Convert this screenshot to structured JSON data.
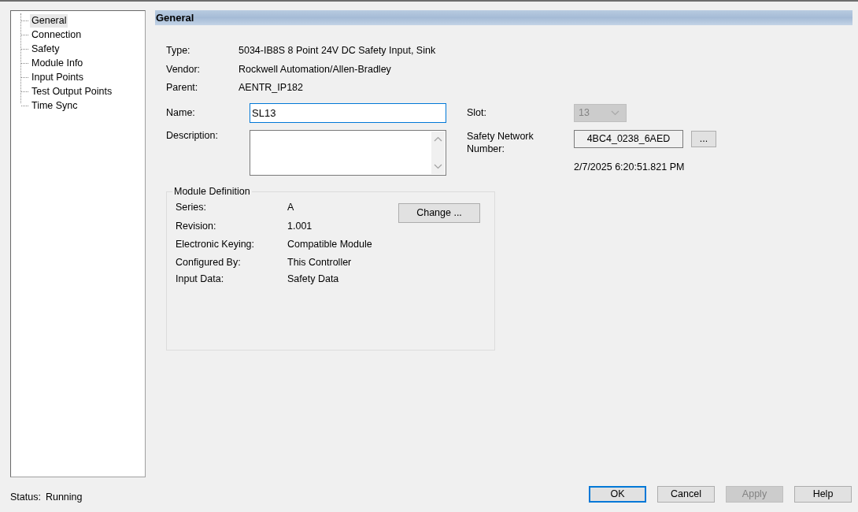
{
  "tree": {
    "items": [
      {
        "label": "General",
        "selected": true
      },
      {
        "label": "Connection",
        "selected": false
      },
      {
        "label": "Safety",
        "selected": false
      },
      {
        "label": "Module Info",
        "selected": false
      },
      {
        "label": "Input Points",
        "selected": false
      },
      {
        "label": "Test Output Points",
        "selected": false
      },
      {
        "label": "Time Sync",
        "selected": false
      }
    ]
  },
  "header": {
    "title": "General"
  },
  "info": [
    {
      "label": "Type:",
      "value": "5034-IB8S 8 Point 24V DC Safety Input, Sink"
    },
    {
      "label": "Vendor:",
      "value": "Rockwell Automation/Allen-Bradley"
    },
    {
      "label": "Parent:",
      "value": "AENTR_IP182"
    }
  ],
  "name": {
    "label": "Name:",
    "value": "SL13"
  },
  "description": {
    "label": "Description:"
  },
  "slot": {
    "label": "Slot:",
    "value": "13",
    "disabled": true
  },
  "safety_network_number": {
    "label": "Safety Network Number:",
    "value": "4BC4_0238_6AED",
    "button": "...",
    "timestamp": "2/7/2025 6:20:51.821 PM"
  },
  "module_definition": {
    "title": "Module Definition",
    "button": "Change ...",
    "rows": [
      {
        "label": "Series:",
        "value": "A"
      },
      {
        "label": "Revision:",
        "value": "1.001"
      },
      {
        "label": "Electronic Keying:",
        "value": "Compatible Module"
      },
      {
        "label": "Configured By:",
        "value": "This Controller"
      },
      {
        "label": "Input Data:",
        "value": "Safety Data"
      }
    ]
  },
  "status_bar": {
    "label": "Status:",
    "value": "Running"
  },
  "buttons": [
    {
      "label": "OK",
      "kind": "default",
      "disabled": false
    },
    {
      "label": "Cancel",
      "kind": "normal",
      "disabled": false
    },
    {
      "label": "Apply",
      "kind": "normal",
      "disabled": true
    },
    {
      "label": "Help",
      "kind": "normal",
      "disabled": false
    }
  ]
}
